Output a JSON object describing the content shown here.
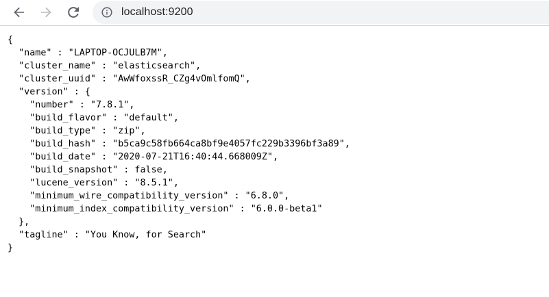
{
  "address_bar": {
    "url": "localhost:9200"
  },
  "icons": {
    "back": "arrow-left-icon",
    "forward": "arrow-right-icon",
    "reload": "reload-icon",
    "site_info": "info-icon"
  },
  "colors": {
    "icon_active": "#5f6368",
    "icon_disabled": "#babcbe",
    "omnibox_bg": "#f1f3f4",
    "text": "#000000"
  },
  "json_lines": [
    "{",
    "  \"name\" : \"LAPTOP-OCJULB7M\",",
    "  \"cluster_name\" : \"elasticsearch\",",
    "  \"cluster_uuid\" : \"AwWfoxssR_CZg4vOmlfomQ\",",
    "  \"version\" : {",
    "    \"number\" : \"7.8.1\",",
    "    \"build_flavor\" : \"default\",",
    "    \"build_type\" : \"zip\",",
    "    \"build_hash\" : \"b5ca9c58fb664ca8bf9e4057fc229b3396bf3a89\",",
    "    \"build_date\" : \"2020-07-21T16:40:44.668009Z\",",
    "    \"build_snapshot\" : false,",
    "    \"lucene_version\" : \"8.5.1\",",
    "    \"minimum_wire_compatibility_version\" : \"6.8.0\",",
    "    \"minimum_index_compatibility_version\" : \"6.0.0-beta1\"",
    "  },",
    "  \"tagline\" : \"You Know, for Search\"",
    "}"
  ]
}
